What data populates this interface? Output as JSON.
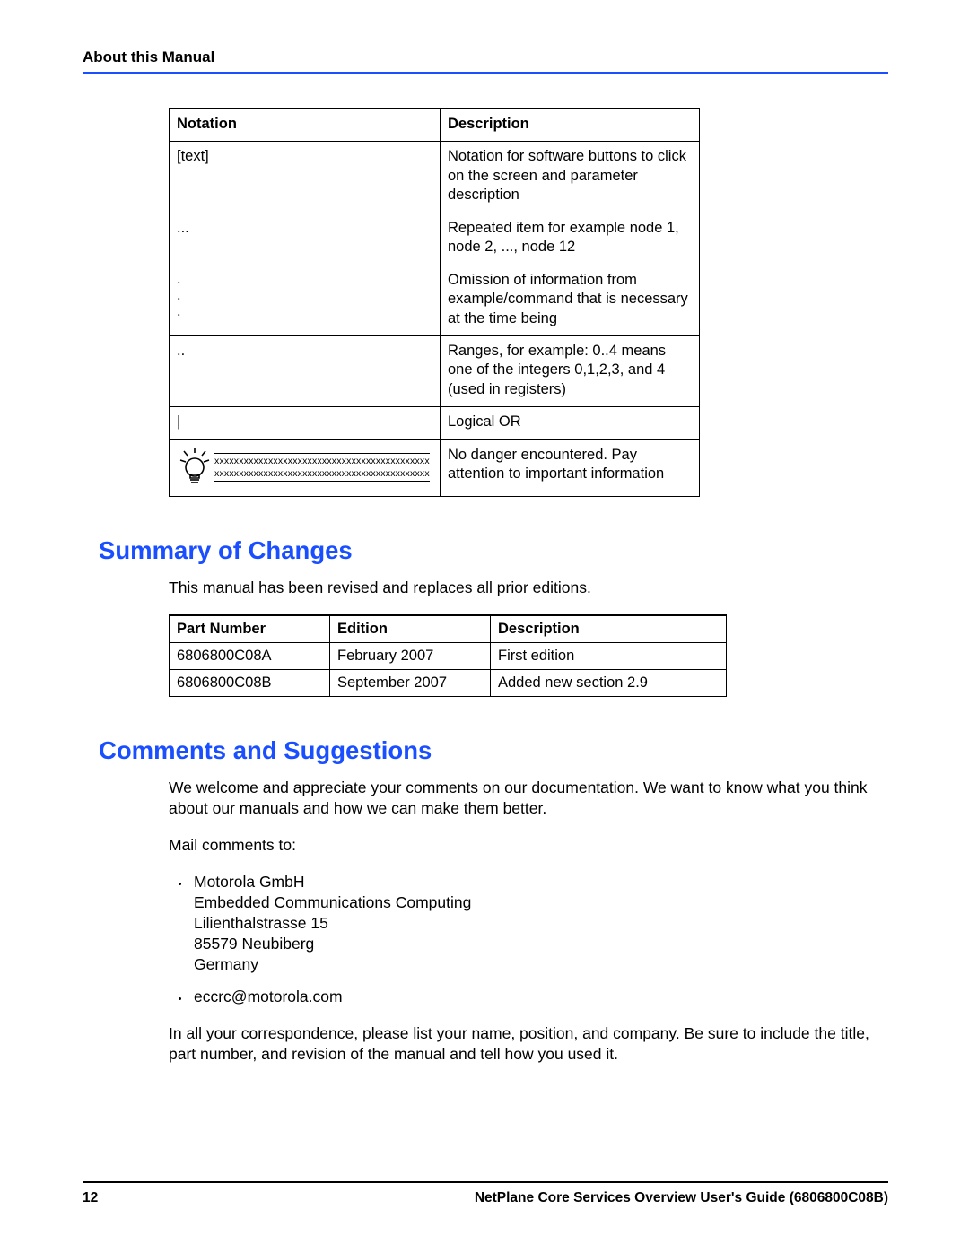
{
  "header": {
    "title": "About this Manual"
  },
  "notation_table": {
    "headers": [
      "Notation",
      "Description"
    ],
    "rows": [
      {
        "notation": "[text]",
        "description": "Notation for software buttons to click on the screen and parameter description"
      },
      {
        "notation": "...",
        "description": "Repeated item for example node 1, node 2, ..., node 12"
      },
      {
        "notation_multiline": [
          ".",
          ".",
          "."
        ],
        "description": "Omission of information from example/command that is necessary at the time being"
      },
      {
        "notation": "..",
        "description": "Ranges, for example: 0..4 means one of the integers 0,1,2,3, and 4 (used in registers)"
      },
      {
        "notation": "|",
        "description": "Logical OR"
      },
      {
        "notation_bulb_lines": [
          "xxxxxxxxxxxxxxxxxxxxxxxxxxxxxxxxxxxxxxxxxxxx",
          "xxxxxxxxxxxxxxxxxxxxxxxxxxxxxxxxxxxxxxxxxxxx"
        ],
        "description": "No danger encountered. Pay attention to important information"
      }
    ]
  },
  "sections": {
    "summary": {
      "title": "Summary of Changes",
      "intro": "This manual has been revised and replaces all prior editions."
    },
    "comments": {
      "title": "Comments and Suggestions",
      "p1": "We welcome and appreciate your comments on our documentation. We want to know what you think about our manuals and how we can make them better.",
      "p2": "Mail comments to:",
      "address_lines": [
        "Motorola GmbH",
        "Embedded Communications Computing",
        "Lilienthalstrasse 15",
        "85579 Neubiberg",
        "Germany"
      ],
      "email": "eccrc@motorola.com",
      "p3": "In all your correspondence, please list your name, position, and company. Be sure to include the title, part number, and revision of the manual and tell how you used it."
    }
  },
  "changes_table": {
    "headers": [
      "Part Number",
      "Edition",
      "Description"
    ],
    "rows": [
      {
        "part": "6806800C08A",
        "edition": "February 2007",
        "description": "First edition"
      },
      {
        "part": "6806800C08B",
        "edition": "September 2007",
        "description": "Added new section 2.9"
      }
    ]
  },
  "footer": {
    "page_number": "12",
    "doc_title": "NetPlane Core Services Overview  User's Guide (6806800C08B)"
  }
}
